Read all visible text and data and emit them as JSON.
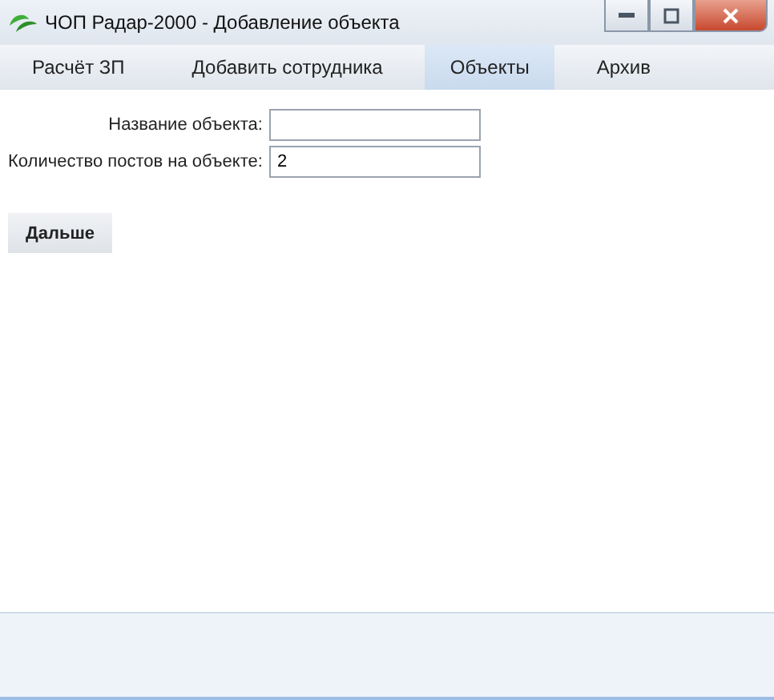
{
  "window": {
    "title": "ЧОП Радар-2000 - Добавление объекта"
  },
  "tabs": [
    {
      "label": "Расчёт ЗП",
      "selected": false
    },
    {
      "label": "Добавить сотрудника",
      "selected": false
    },
    {
      "label": "Объекты",
      "selected": true
    },
    {
      "label": "Архив",
      "selected": false
    }
  ],
  "form": {
    "fields": [
      {
        "label": "Название объекта:"
      },
      {
        "label": "Количество постов на объекте:",
        "value": "2"
      }
    ],
    "button": "Дальше"
  }
}
